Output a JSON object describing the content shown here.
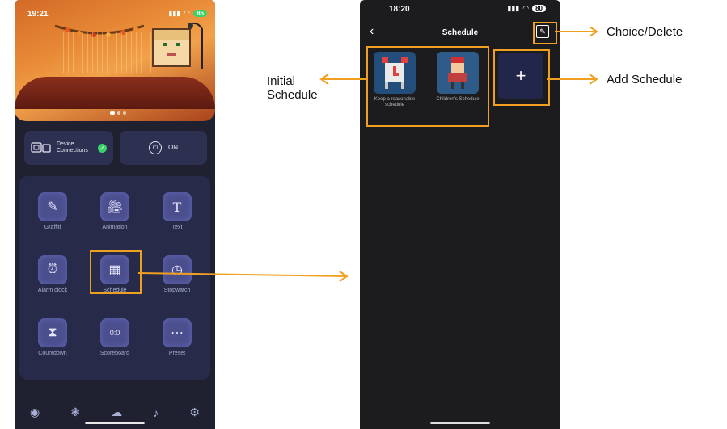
{
  "left_phone": {
    "status_time": "19:21",
    "battery": "85",
    "device_connections_label": "Device Connections",
    "power_label": "ON",
    "tiles": [
      {
        "label": "Graffiti",
        "icon": "graffiti-icon"
      },
      {
        "label": "Animation",
        "icon": "animation-icon"
      },
      {
        "label": "Text",
        "icon": "text-icon"
      },
      {
        "label": "Alarm clock",
        "icon": "alarm-clock-icon"
      },
      {
        "label": "Schedule",
        "icon": "schedule-icon"
      },
      {
        "label": "Stopwatch",
        "icon": "stopwatch-icon"
      },
      {
        "label": "Countdown",
        "icon": "countdown-icon"
      },
      {
        "label": "Scoreboard",
        "icon": "scoreboard-icon"
      },
      {
        "label": "Preset",
        "icon": "preset-icon"
      }
    ],
    "nav_icons": [
      "explore-icon",
      "effects-icon",
      "cloud-icon",
      "music-icon",
      "settings-icon"
    ]
  },
  "right_phone": {
    "status_time": "18:20",
    "battery": "80",
    "title": "Schedule",
    "schedules": [
      {
        "label": "Keep a reasonable schedule",
        "icon": "alarm-clock-pixel-icon"
      },
      {
        "label": "Children's Schedule",
        "icon": "child-pixel-icon"
      }
    ]
  },
  "annotations": {
    "initial": "Initial Schedule",
    "choice_delete": "Choice/Delete",
    "add_schedule": "Add Schedule"
  },
  "colors": {
    "highlight": "#f0a020",
    "tile_bg": "#4b4f8e",
    "check_green": "#3cd26a"
  }
}
